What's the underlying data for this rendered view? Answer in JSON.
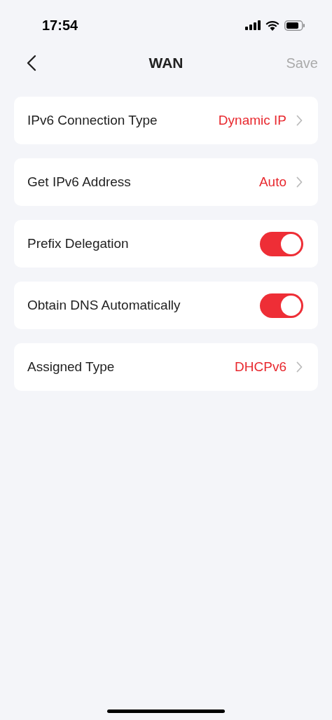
{
  "status_bar": {
    "time": "17:54"
  },
  "nav": {
    "title": "WAN",
    "save": {
      "label": "Save",
      "disabled": true
    }
  },
  "rows": [
    {
      "kind": "select",
      "label": "IPv6 Connection Type",
      "value": "Dynamic IP"
    },
    {
      "kind": "select",
      "label": "Get IPv6 Address",
      "value": "Auto"
    },
    {
      "kind": "toggle",
      "label": "Prefix Delegation",
      "on": true
    },
    {
      "kind": "toggle",
      "label": "Obtain DNS Automatically",
      "on": true
    },
    {
      "kind": "select",
      "label": "Assigned Type",
      "value": "DHCPv6"
    }
  ]
}
